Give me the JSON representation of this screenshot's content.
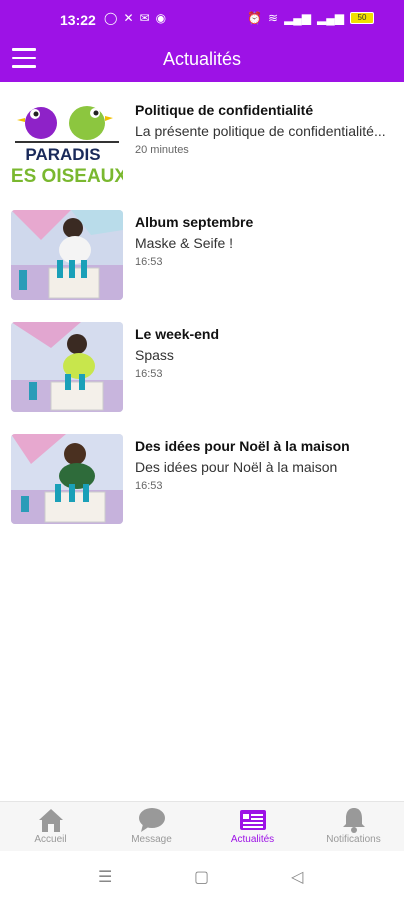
{
  "status": {
    "time": "13:22",
    "left_icons": [
      "whatsapp-icon",
      "x-icon",
      "mail-icon",
      "app-icon"
    ],
    "right_icons": [
      "alarm-icon",
      "wifi-icon",
      "signal-icon",
      "signal2-icon"
    ],
    "battery": "50"
  },
  "appbar": {
    "title": "Actualités"
  },
  "items": [
    {
      "title": "Politique de confidentialité",
      "subtitle": "La présente politique de confidentialité...",
      "time": "20 minutes",
      "thumb": "logo",
      "logo_line1": "PARADIS",
      "logo_line2": "ES OISEAUX"
    },
    {
      "title": "Album septembre",
      "subtitle": "Maske & Seife !",
      "time": "16:53",
      "thumb": "photo"
    },
    {
      "title": "Le week-end",
      "subtitle": "Spass",
      "time": "16:53",
      "thumb": "photo"
    },
    {
      "title": "Des idées pour Noël à la maison",
      "subtitle": "Des idées pour Noël à la maison",
      "time": "16:53",
      "thumb": "photo"
    }
  ],
  "nav": [
    {
      "label": "Accueil",
      "icon": "home-icon"
    },
    {
      "label": "Message",
      "icon": "chat-icon"
    },
    {
      "label": "Actualités",
      "icon": "news-icon",
      "active": true
    },
    {
      "label": "Notifications",
      "icon": "bell-icon"
    }
  ],
  "colors": {
    "primary": "#9d12e6",
    "inactive": "#999999"
  }
}
